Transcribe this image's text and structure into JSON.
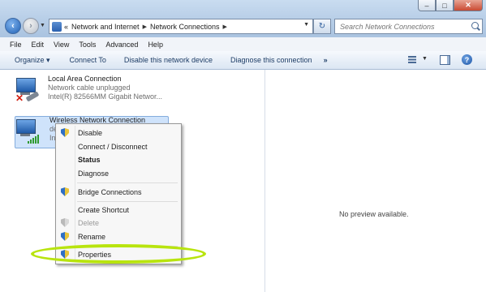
{
  "window": {
    "controls": {
      "minimize": "–",
      "maximize": "□",
      "close": "✕"
    }
  },
  "nav": {
    "back_icon": "back-arrow-icon",
    "forward_icon": "forward-arrow-icon",
    "breadcrumb": {
      "overflow": "«",
      "items": [
        "Network and Internet",
        "Network Connections"
      ]
    },
    "refresh_icon": "refresh-icon",
    "search": {
      "placeholder": "Search Network Connections",
      "icon": "search-icon"
    }
  },
  "menubar": {
    "items": [
      "File",
      "Edit",
      "View",
      "Tools",
      "Advanced",
      "Help"
    ]
  },
  "commandbar": {
    "organize": "Organize ▾",
    "connect_to": "Connect To",
    "disable_device": "Disable this network device",
    "diagnose": "Diagnose this connection",
    "more": "»"
  },
  "connections": [
    {
      "name": "Local Area Connection",
      "status": "Network cable unplugged",
      "adapter": "Intel(R) 82566MM Gigabit Networ...",
      "icon": "wired-network-disconnected-icon"
    },
    {
      "name": "Wireless Network Connection",
      "status_partial": "de",
      "adapter_partial": "Int",
      "icon": "wireless-network-icon",
      "selected": true
    }
  ],
  "context_menu": {
    "items": [
      {
        "label": "Disable",
        "icon": "shield-icon",
        "style": "normal"
      },
      {
        "label": "Connect / Disconnect",
        "icon": "",
        "style": "normal"
      },
      {
        "label": "Status",
        "icon": "",
        "style": "bold"
      },
      {
        "label": "Diagnose",
        "icon": "",
        "style": "normal"
      },
      {
        "label": "Bridge Connections",
        "icon": "shield-icon",
        "style": "normal"
      },
      {
        "label": "Create Shortcut",
        "icon": "",
        "style": "normal"
      },
      {
        "label": "Delete",
        "icon": "shield-icon",
        "style": "disabled"
      },
      {
        "label": "Rename",
        "icon": "shield-icon",
        "style": "normal"
      },
      {
        "label": "Properties",
        "icon": "shield-icon",
        "style": "normal",
        "highlighted": true
      }
    ]
  },
  "preview": {
    "text": "No preview available."
  },
  "colors": {
    "highlight_ring": "#b8e40e",
    "selection": "#cfe3fb"
  }
}
